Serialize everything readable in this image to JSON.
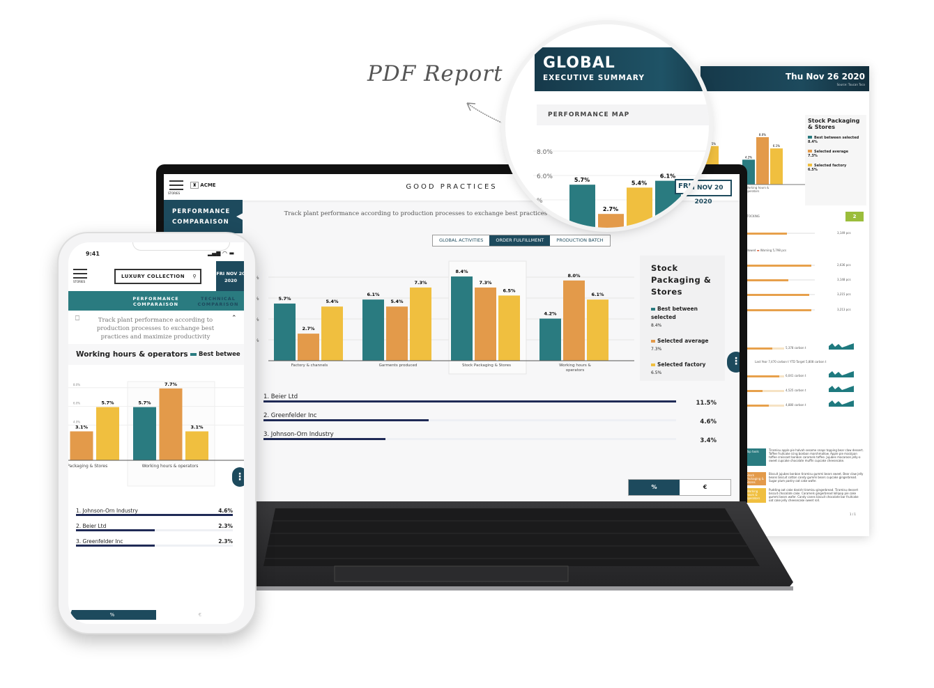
{
  "caption": "PDF Report",
  "colors": {
    "teal": "#2a7b80",
    "orange": "#e39a4a",
    "yellow": "#f0bf3f",
    "navy": "#1d4a5d",
    "rank_bar": "#1f2a56",
    "badge_green": "#9bbd3b"
  },
  "pdf": {
    "title": "GLOBAL",
    "subtitle": "EXECUTIVE SUMMARY",
    "date": "Thu Nov 26 2020",
    "source": "Source: Toucan Toco",
    "section": "PERFORMANCE MAP",
    "y_ticks": [
      "8.0%",
      "6.0%",
      "%"
    ],
    "zoom_bars": [
      {
        "label": "5.7%",
        "value": 5.7,
        "color": "teal"
      },
      {
        "label": "2.7%",
        "value": 2.7,
        "color": "orange"
      },
      {
        "label": "5.4%",
        "value": 5.4,
        "color": "yellow"
      },
      {
        "label": "6.1%",
        "value": 6.1,
        "color": "teal"
      }
    ],
    "mini_bars": [
      {
        "label": "6.5%",
        "value": 6.5,
        "color": "yellow"
      },
      {
        "label": "4.2%",
        "value": 4.2,
        "color": "teal"
      },
      {
        "label": "8.0%",
        "value": 8.0,
        "color": "orange"
      },
      {
        "label": "6.1%",
        "value": 6.1,
        "color": "yellow"
      }
    ],
    "mini_category": "Working hours & operators",
    "legend": {
      "title": "Stock Packaging & Stores",
      "items": [
        {
          "label": "Best between selected",
          "value": "8.4%"
        },
        {
          "label": "Selected average",
          "value": "7.3%"
        },
        {
          "label": "Selected factory",
          "value": "6.5%"
        }
      ]
    },
    "stock_header": "STOCKING",
    "page_badge": "2",
    "stock_legend": [
      "allowed",
      "Warning",
      "5,798 pcs"
    ],
    "stock_rows": [
      "3,149 pcs",
      "2,636 pcs",
      "3,148 pcs",
      "3,215 pcs",
      "3,213 pcs"
    ],
    "carbon_legend": [
      "Last Year",
      "7,470 carbon t",
      "YTD Target",
      "5,808 carbon t"
    ],
    "carbon_rows": [
      "5,378 carbon t",
      "6,041 carbon t",
      "4,525 carbon t",
      "4,880 carbon t"
    ],
    "text_blocks": [
      {
        "tag": "Top tools",
        "text": "Tiramisu apple pie halvah sesame snaps topping bear claw dessert. Toffee fruitcake icing bonbon marshmallow. Apple pie marzipan toffee croissant bonbon caramels toffee. Jujubes macaroon jelly-o sweet cupcake chocolate muffin cupcake cheesecake."
      },
      {
        "tag": "Stock Packaging & Stores",
        "text": "Biscuit jujubes bonbon tiramisu gummi bears sweet. Bear claw jelly beans biscuit cotton candy gummi bears cupcake gingerbread. Sugar plum pastry oat cake wafer."
      },
      {
        "tag": "Working hours & operators",
        "text": "Pudding oat cake danish tiramisu gingerbread. Tiramisu dessert biscuit chocolate cake. Caramels gingerbread lollipop pie cake gummi bears wafer. Candy canes biscuit chocolate bar fruitcake oat cake jelly cheesecake sweet roll."
      }
    ],
    "page_num": "1 / 1"
  },
  "laptop": {
    "menu_label": "STORIES",
    "logo": "ACME",
    "title": "GOOD PRACTICES",
    "date": "FRI NOV 20 2020",
    "side_tab": "PERFORMANCE COMPARAISON",
    "description": "Track plant performance according to production processes to exchange best practices and maximize productivity",
    "tabs": [
      {
        "label": "GLOBAL ACTIVITIES",
        "active": false
      },
      {
        "label": "ORDER FULFILLMENT",
        "active": true
      },
      {
        "label": "PRODUCTION BATCH",
        "active": false
      }
    ],
    "legend": {
      "title": "Stock Packaging & Stores",
      "items": [
        {
          "label": "Best between selected",
          "value": "8.4%",
          "color": "teal"
        },
        {
          "label": "Selected average",
          "value": "7.3%",
          "color": "orange"
        },
        {
          "label": "Selected factory",
          "value": "6.5%",
          "color": "yellow"
        }
      ]
    },
    "ranking": [
      {
        "name": "1. Beier Ltd",
        "value": "11.5%",
        "pct": 11.5
      },
      {
        "name": "2. Greenfelder Inc",
        "value": "4.6%",
        "pct": 4.6
      },
      {
        "name": "3. Johnson-Orn Industry",
        "value": "3.4%",
        "pct": 3.4
      }
    ],
    "toggle": [
      "%",
      "€"
    ],
    "more": "⋮"
  },
  "phone": {
    "time": "9:41",
    "menu_label": "STORIES",
    "search": "LUXURY COLLECTION",
    "date": "FRI NOV 20 2020",
    "tabs": [
      "PERFORMANCE COMPARAISON",
      "TECHNICAL COMPARISON"
    ],
    "description": "Track plant performance according to production processes to exchange best practices and maximize productivity",
    "chart_title": "Working hours & operators",
    "legend_partial": "Best betwee",
    "ranking": [
      {
        "name": "1. Johnson-Orn Industry",
        "value": "4.6%",
        "pct": 4.6
      },
      {
        "name": "2. Beier Ltd",
        "value": "2.3%",
        "pct": 2.3
      },
      {
        "name": "3. Greenfelder Inc",
        "value": "2.3%",
        "pct": 2.3
      }
    ],
    "toggle": [
      "%",
      "€"
    ]
  },
  "chart_data": [
    {
      "type": "bar",
      "series": [
        {
          "name": "Best between selected"
        },
        {
          "name": "Selected average"
        },
        {
          "name": "Selected factory"
        }
      ],
      "categories": [
        "Factory & channels",
        "Garments produced",
        "Stock Packaging & Stores",
        "Working hours & operators"
      ],
      "values": [
        [
          5.7,
          2.7,
          5.4
        ],
        [
          6.1,
          5.4,
          7.3
        ],
        [
          8.4,
          7.3,
          6.5
        ],
        [
          4.2,
          8.0,
          6.1
        ]
      ],
      "highlighted": "Stock Packaging & Stores",
      "ylim": [
        0,
        9
      ]
    },
    {
      "type": "bar",
      "categories": [
        "Stock Packaging & Stores",
        "Working hours & operators"
      ],
      "values": [
        [
          null,
          3.1,
          5.7
        ],
        [
          5.7,
          7.7,
          3.1
        ]
      ],
      "y_ticks": [
        "8.0%",
        "6.0%",
        "4.0%"
      ],
      "ylim": [
        0,
        9
      ]
    }
  ]
}
